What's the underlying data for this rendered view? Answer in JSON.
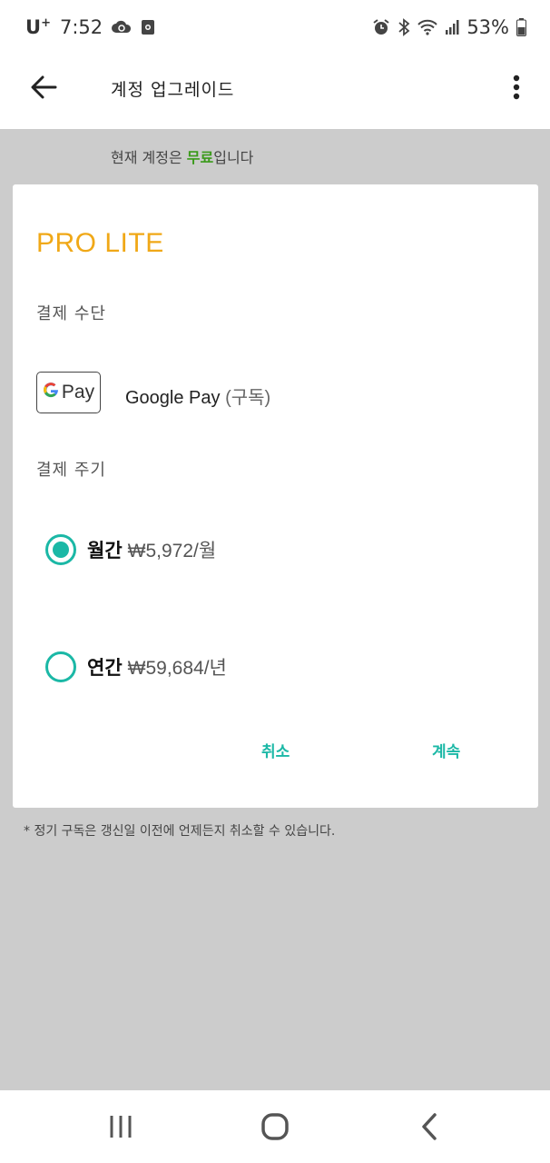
{
  "status_bar": {
    "carrier": "U",
    "carrier_sup": "+",
    "time": "7:52",
    "battery": "53%",
    "icons": [
      "cloud-sync-icon",
      "screen-record-icon",
      "alarm-icon",
      "bluetooth-icon",
      "wifi-icon",
      "signal-icon",
      "battery-icon"
    ]
  },
  "app_bar": {
    "title": "계정 업그레이드",
    "back_icon": "arrow-left-icon",
    "more_icon": "more-vert-icon"
  },
  "account_note": {
    "prefix": "현재 계정은 ",
    "plan": "무료",
    "suffix": "입니다"
  },
  "card": {
    "plan_title": "PRO LITE",
    "payment_method_label": "결제 수단",
    "payment_method": {
      "badge_g": "G",
      "badge_pay": "Pay",
      "name": "Google Pay",
      "detail": "(구독)"
    },
    "billing_cycle_label": "결제 주기",
    "options": [
      {
        "name": "월간",
        "price": "₩5,972/월",
        "selected": true
      },
      {
        "name": "연간",
        "price": "₩59,684/년",
        "selected": false
      }
    ],
    "cancel_label": "취소",
    "continue_label": "계속"
  },
  "footnote": "* 정기 구독은 갱신일 이전에 언제든지 취소할 수 있습니다.",
  "colors": {
    "accent": "#1bb8a6",
    "plan_title": "#f0a817",
    "free_text": "#3a9a1a",
    "overlay_bg": "#cccccc"
  },
  "nav_bar": {
    "icons": [
      "recent-apps-icon",
      "home-icon",
      "back-nav-icon"
    ]
  }
}
